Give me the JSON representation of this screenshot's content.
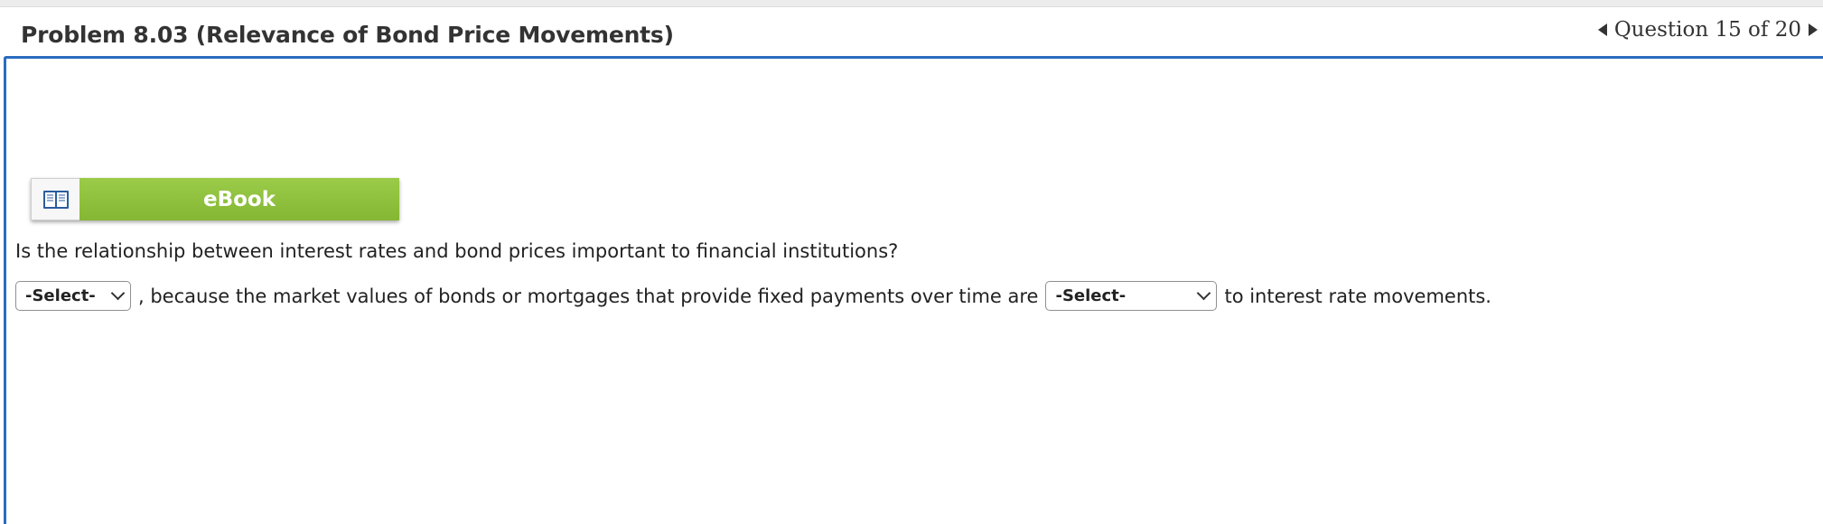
{
  "header": {
    "title": "Problem 8.03 (Relevance of Bond Price Movements)",
    "question_counter": "Question 15 of 20"
  },
  "ebook": {
    "label": "eBook",
    "icon": "book-icon"
  },
  "question": {
    "text": "Is the relationship between interest rates and bond prices important to financial institutions?"
  },
  "answer": {
    "select1_value": "-Select-",
    "text_middle": ", because the market values of bonds or mortgages that provide fixed payments over time are",
    "select2_value": "-Select-",
    "text_end": "to interest rate movements."
  },
  "colors": {
    "accent_border": "#2a6bbf",
    "ebook_green": "#8cc03e"
  }
}
